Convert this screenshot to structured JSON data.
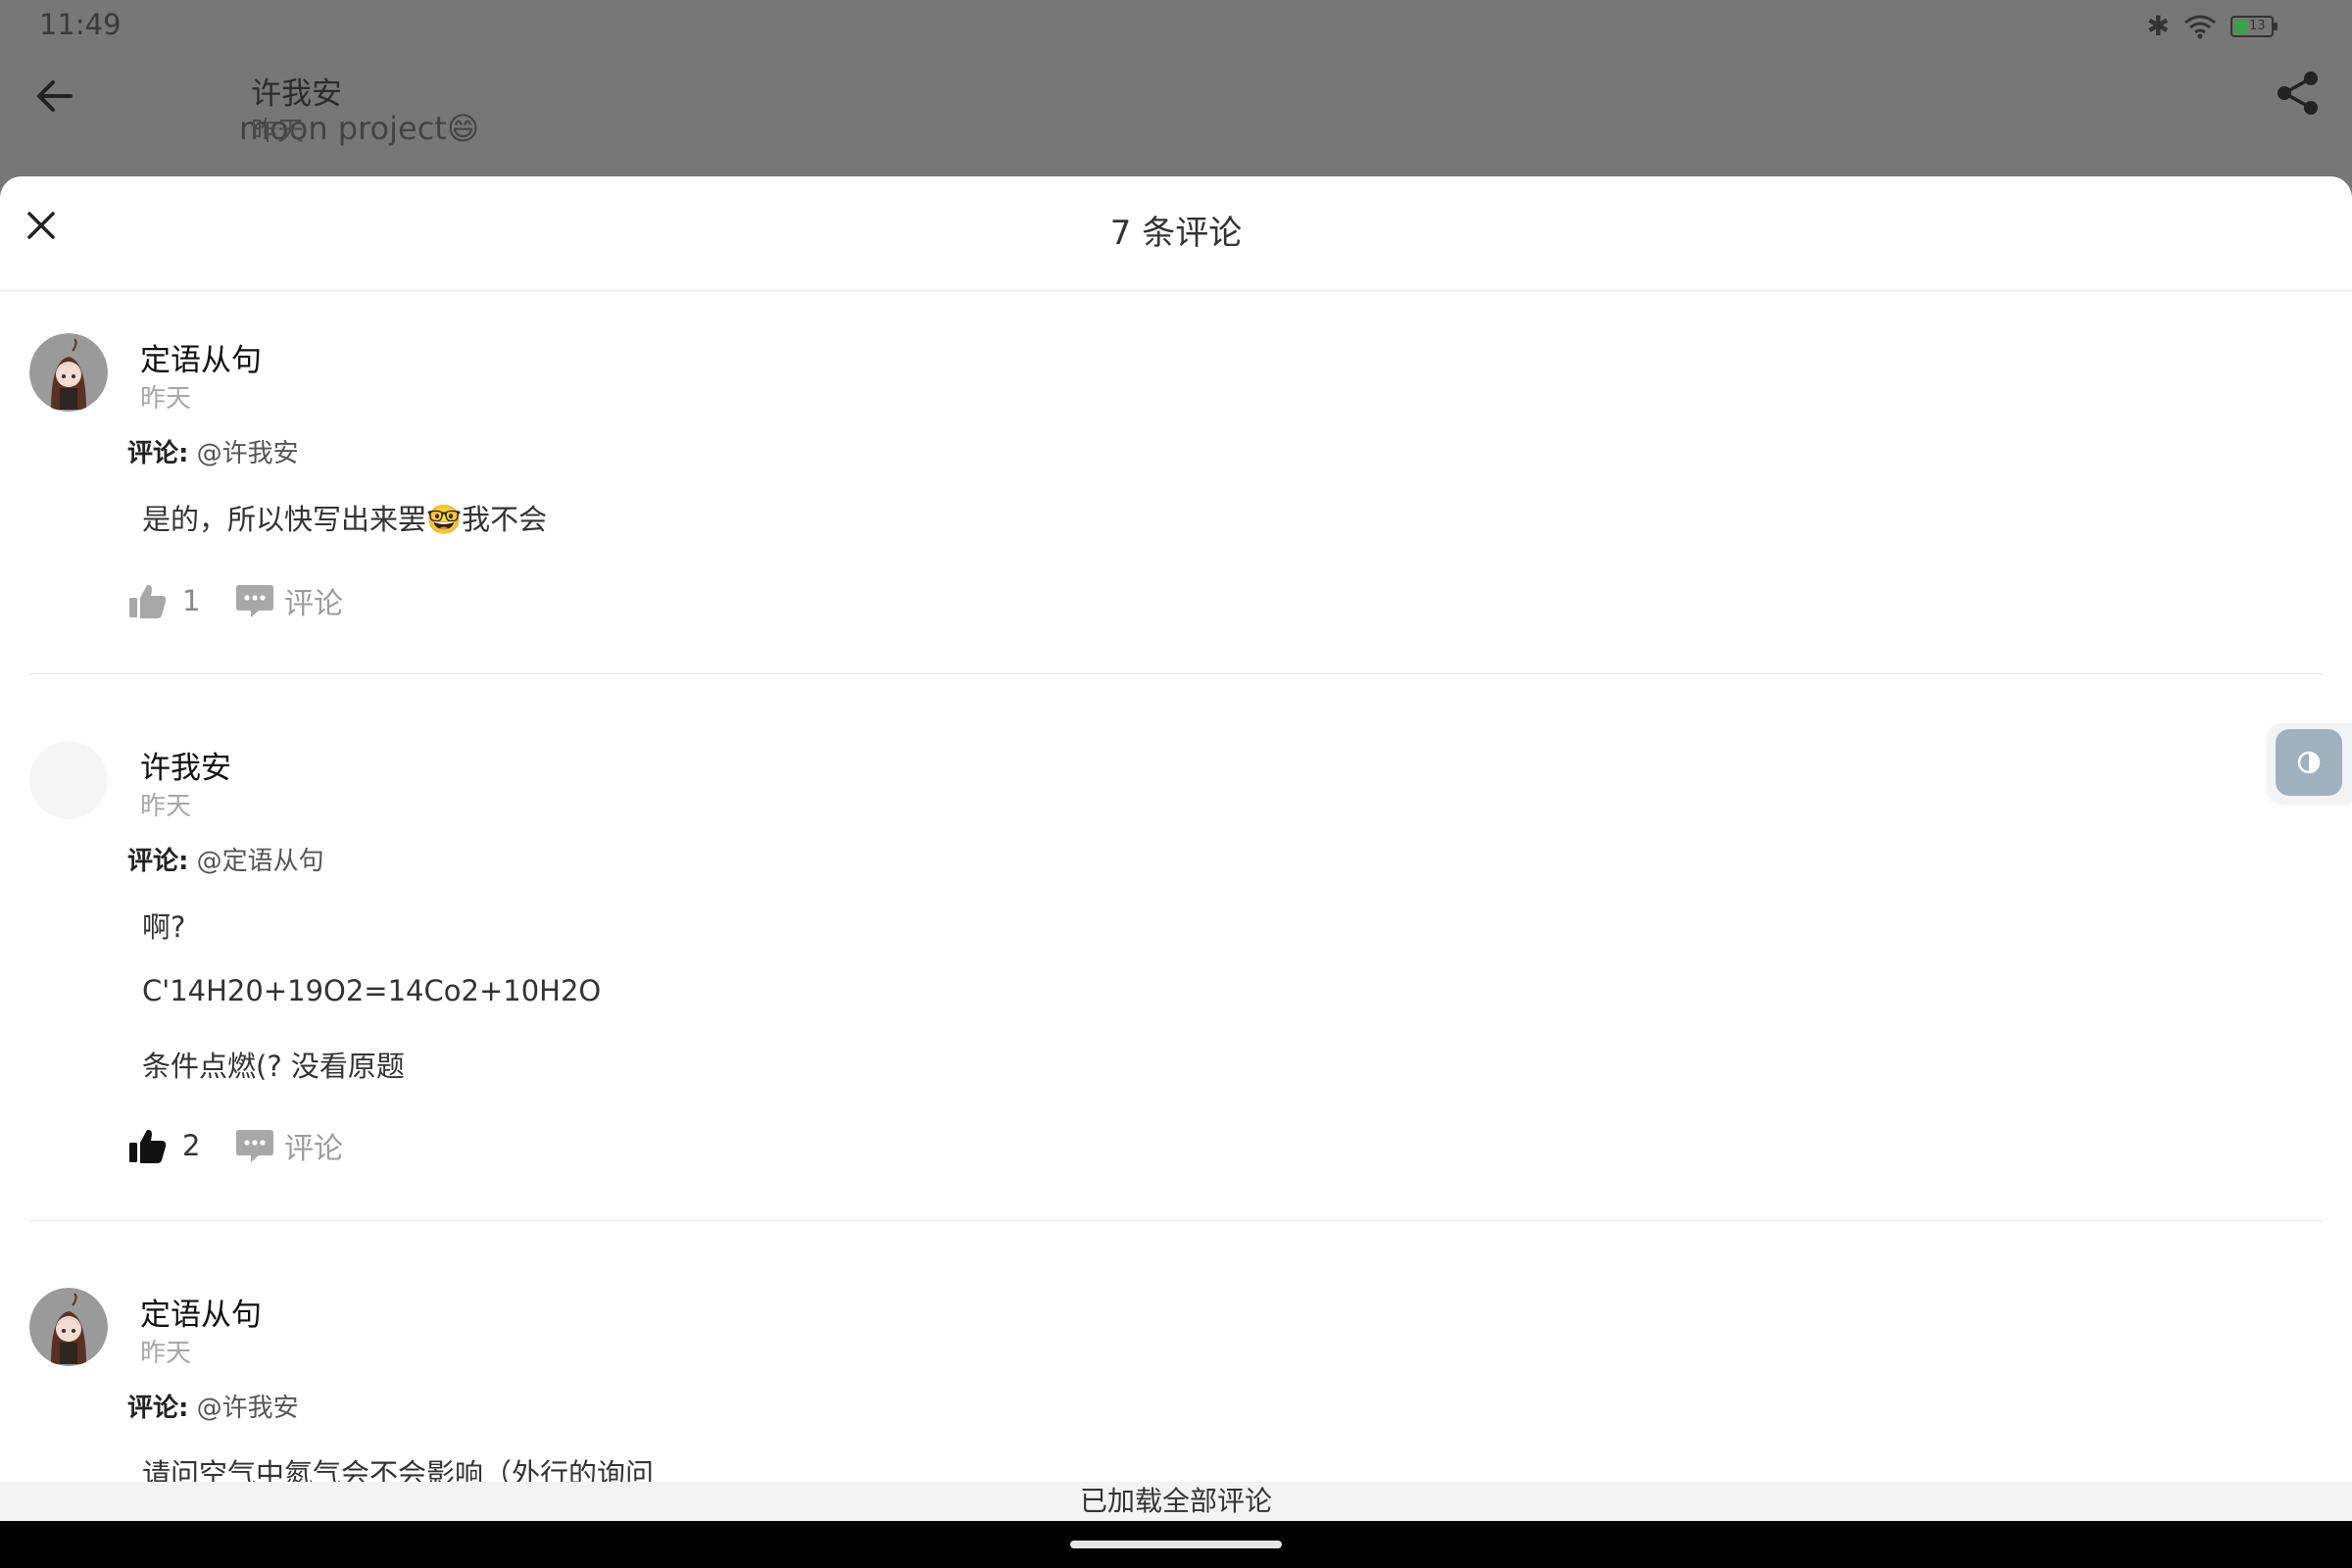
{
  "status_bar": {
    "time": "11:49",
    "battery_level": "13"
  },
  "background_post": {
    "author": "许我安",
    "date": "昨天",
    "title_fragment": "moon project😄"
  },
  "sheet": {
    "title": "7 条评论",
    "footer": "已加载全部评论"
  },
  "comments": [
    {
      "author": "定语从句",
      "date": "昨天",
      "reply_prefix": "评论:",
      "reply_target": "@许我安",
      "body": [
        "是的，所以快写出来罢🤓我不会"
      ],
      "likes": "1",
      "liked": false,
      "reply_label": "评论"
    },
    {
      "author": "许我安",
      "date": "昨天",
      "reply_prefix": "评论:",
      "reply_target": "@定语从句",
      "body": [
        "啊?",
        "C'14H20+19O2=14Co2+10H2O",
        "条件点燃(?  没看原题"
      ],
      "likes": "2",
      "liked": true,
      "reply_label": "评论"
    },
    {
      "author": "定语从句",
      "date": "昨天",
      "reply_prefix": "评论:",
      "reply_target": "@许我安",
      "body": [
        "请问空气中氮气会不会影响（外行的询问"
      ]
    }
  ],
  "icons": {
    "back": "back-arrow-icon",
    "share": "share-icon",
    "close": "close-icon",
    "like": "thumbs-up-icon",
    "reply": "chat-bubble-icon",
    "theme": "contrast-icon"
  },
  "colors": {
    "like_inactive": "#a8a8a8",
    "like_active": "#111111",
    "toggle_bg": "#9fb1bd"
  }
}
